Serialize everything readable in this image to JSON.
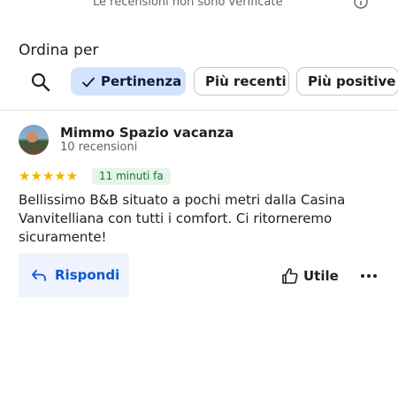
{
  "header": {
    "disclaimer": "Le recensioni non sono verificate",
    "info_icon": "info-icon"
  },
  "sort": {
    "title": "Ordina per",
    "search_icon": "search-icon",
    "options": [
      {
        "label": "Pertinenza",
        "selected": true
      },
      {
        "label": "Più recenti",
        "selected": false
      },
      {
        "label": "Più positive",
        "selected": false
      }
    ]
  },
  "review": {
    "author": "Mimmo Spazio vacanza",
    "author_meta": "10 recensioni",
    "rating": 5,
    "rating_max": 5,
    "stars_display": "★★★★★",
    "time_ago": "11 minuti fa",
    "text": "Bellissimo B&B situato a pochi metri dalla Casina Vanvitelliana con tutti i comfort. Ci ritorneremo sicuramente!",
    "actions": {
      "reply_label": "Rispondi",
      "useful_label": "Utile",
      "more_icon": "more-horizontal-icon"
    }
  },
  "colors": {
    "accent": "#0b57d0",
    "chip_selected_bg": "#d3e3fd",
    "star": "#f4b400",
    "badge_bg": "#e6f4ea",
    "badge_text": "#137333",
    "reply_bg": "#eef3fd"
  }
}
